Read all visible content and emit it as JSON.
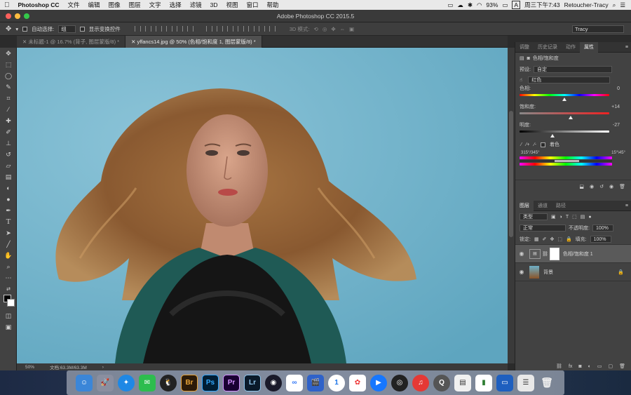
{
  "menubar": {
    "apple": "",
    "app_name": "Photoshop CC",
    "items": [
      "文件",
      "编辑",
      "图像",
      "图层",
      "文字",
      "选择",
      "滤镜",
      "3D",
      "视图",
      "窗口",
      "帮助"
    ],
    "battery": "93%",
    "clock": "周三下午7:43",
    "user": "Retoucher-Tracy"
  },
  "window": {
    "title": "Adobe Photoshop CC 2015.5"
  },
  "options_bar": {
    "auto_select_label": "自动选择:",
    "auto_select_value": "组",
    "show_transform_label": "显示变换控件",
    "mode_3d_label": "3D 模式:",
    "workspace": "Tracy"
  },
  "tabs": [
    {
      "label": "未标题-1 @ 16.7% (背子, 图层蒙版/8) *",
      "active": false
    },
    {
      "label": "yffancs14.jpg @ 50% (色相/饱和度 1, 图层蒙版/8) *",
      "active": true
    }
  ],
  "status": {
    "zoom": "50%",
    "doc": "文档:63.3M/63.3M"
  },
  "properties": {
    "tabs": [
      "调整",
      "历史记录",
      "动作",
      "属性"
    ],
    "active_tab": "属性",
    "header_title": "色相/饱和度",
    "preset_label": "预设:",
    "preset_value": "自定",
    "channel_value": "红色",
    "hue_label": "色相:",
    "hue_value": "0",
    "sat_label": "饱和度:",
    "sat_value": "+14",
    "light_label": "明度:",
    "light_value": "-27",
    "colorize_label": "着色",
    "range_left": "315°/345°",
    "range_right": "15°\\45°"
  },
  "levels": {
    "hue": 0,
    "saturation": 14,
    "lightness": -27
  },
  "layers": {
    "tabs": [
      "图层",
      "通道",
      "路径"
    ],
    "active_tab": "图层",
    "filter_label": "类型",
    "blend_mode": "正常",
    "opacity_label": "不透明度:",
    "opacity_value": "100%",
    "lock_label": "锁定:",
    "fill_label": "填充:",
    "fill_value": "100%",
    "items": [
      {
        "name": "色相/饱和度 1"
      },
      {
        "name": "背景"
      }
    ]
  },
  "dock": {
    "apps": [
      "Finder",
      "Launchpad",
      "Safari",
      "WeChat",
      "QQ",
      "Br",
      "Ps",
      "Pr",
      "Lr",
      "Cinema",
      "Baidu",
      "Movie",
      "1Password",
      "Tools",
      "Player",
      "OBS",
      "NetEase",
      "QuickTime",
      "Preview",
      "Chart",
      "Keynote",
      "Notes",
      "Trash"
    ]
  },
  "colors": {
    "accent": "#4a90d9",
    "canvas_sky": "#6db0c8",
    "panel": "#424242"
  }
}
